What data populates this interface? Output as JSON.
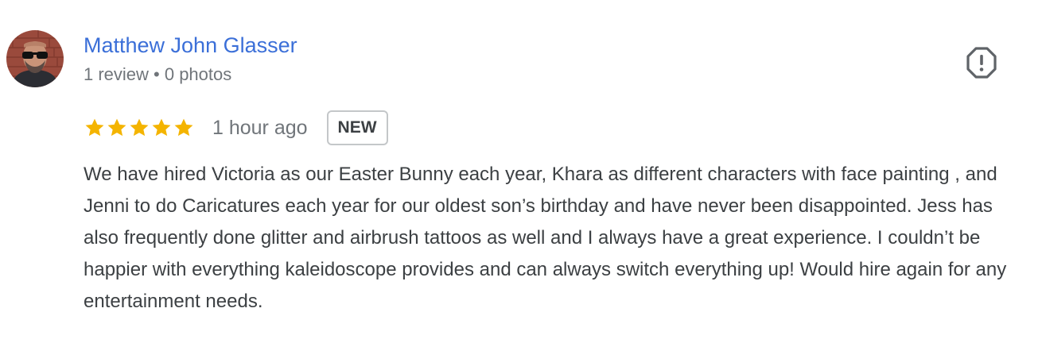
{
  "review": {
    "author": {
      "name": "Matthew John Glasser",
      "meta": "1 review • 0 photos",
      "avatar_icon": "user-photo"
    },
    "rating": {
      "stars": 5,
      "max_stars": 5,
      "star_color": "#f4b400"
    },
    "time_ago": "1 hour ago",
    "badge": "NEW",
    "text": "We have hired Victoria as our Easter Bunny each year, Khara as different characters with face painting , and Jenni to do Caricatures each year for our oldest son’s birthday and have never been disappointed. Jess has also frequently done glitter and airbrush tattoos as well and I always have a great experience. I couldn’t be happier with everything kaleidoscope provides and can always switch everything up! Would hire again for any entertainment needs.",
    "report_icon": "report-flag-icon"
  },
  "colors": {
    "author_link": "#3b6fd8",
    "meta_text": "#70757a",
    "body_text": "#3c4043",
    "badge_border": "#c4c7c9"
  }
}
